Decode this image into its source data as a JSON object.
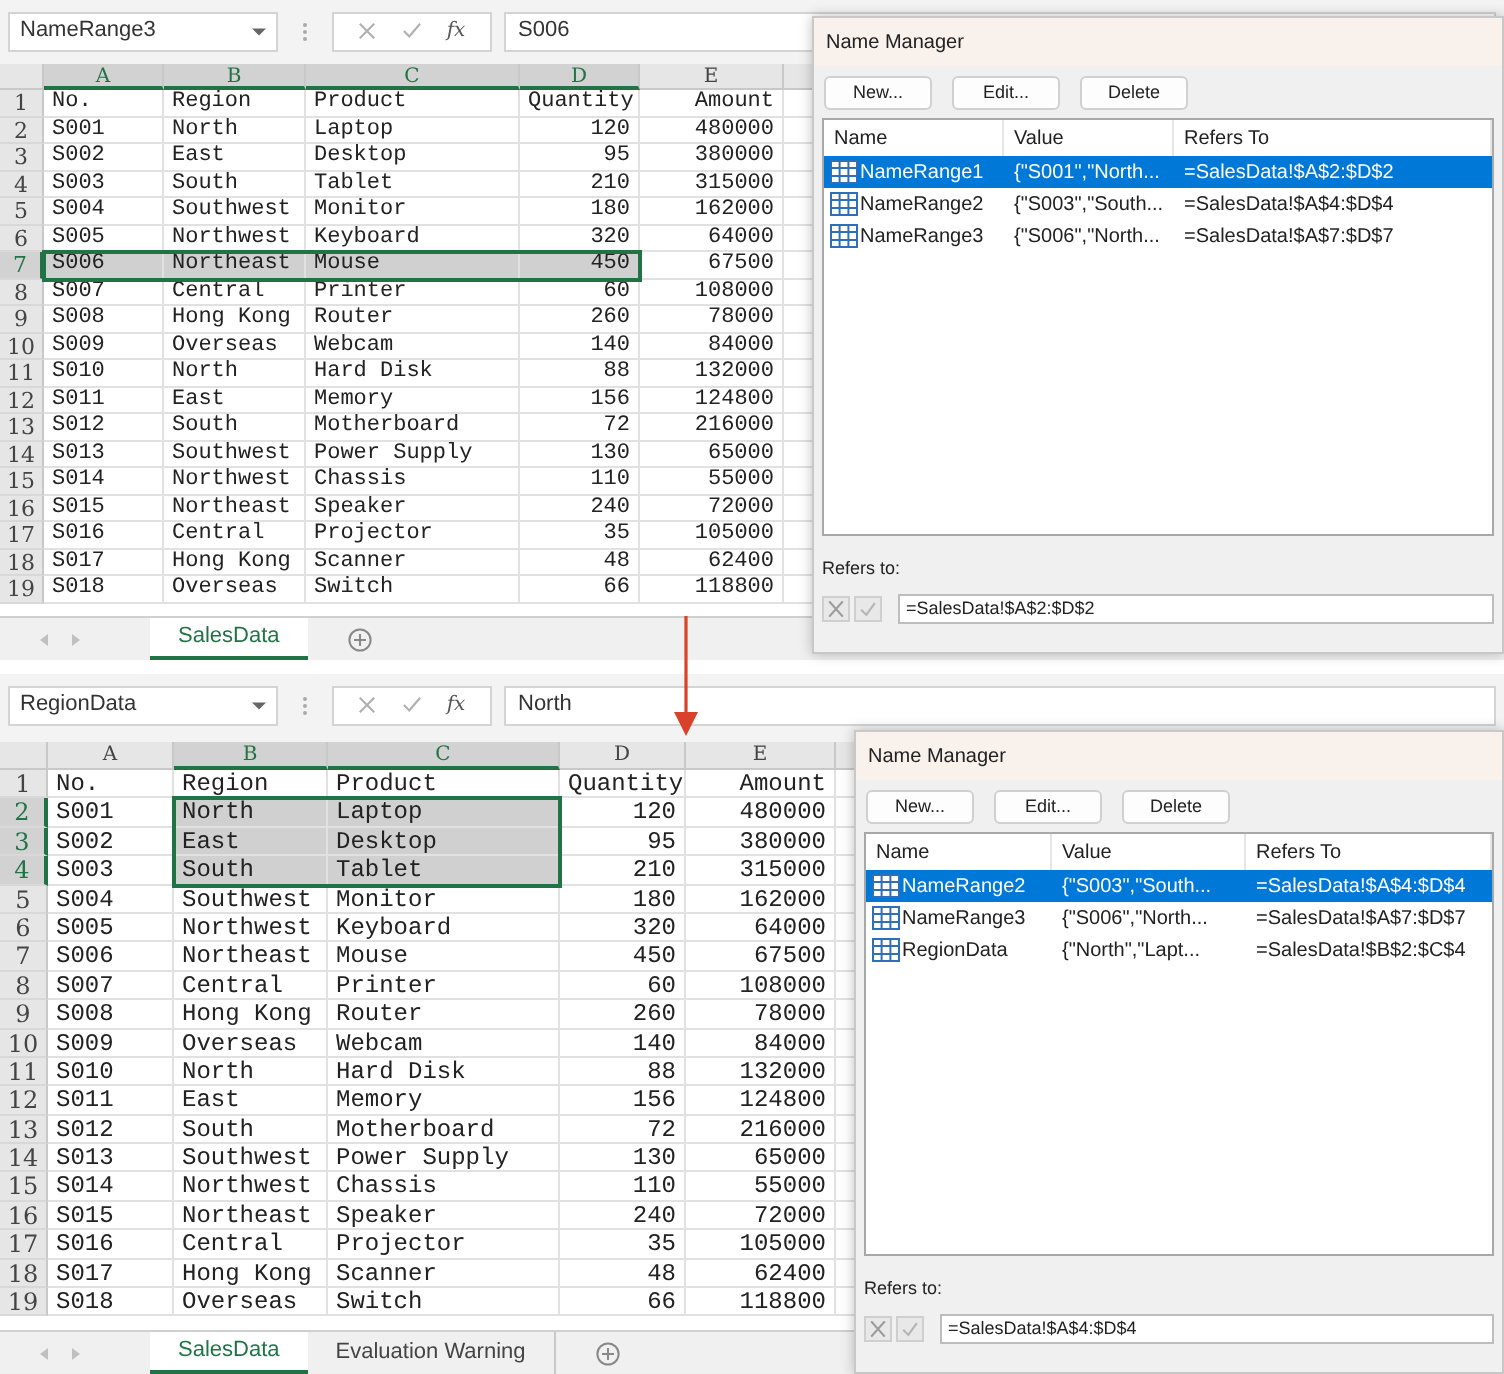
{
  "panels": [
    {
      "name_box": "NameRange3",
      "function_label": "fx",
      "formula": "S006",
      "columns": [
        {
          "label": "A",
          "selected": true
        },
        {
          "label": "B",
          "selected": true
        },
        {
          "label": "C",
          "selected": true
        },
        {
          "label": "D",
          "selected": true
        },
        {
          "label": "E",
          "selected": false
        }
      ],
      "rows": [
        {
          "number": "1",
          "selected": false,
          "cells": [
            "No.",
            "Region",
            "Product",
            "Quantity",
            "Amount"
          ]
        },
        {
          "number": "2",
          "selected": false,
          "cells": [
            "S001",
            "North",
            "Laptop",
            "120",
            "480000"
          ]
        },
        {
          "number": "3",
          "selected": false,
          "cells": [
            "S002",
            "East",
            "Desktop",
            "95",
            "380000"
          ]
        },
        {
          "number": "4",
          "selected": false,
          "cells": [
            "S003",
            "South",
            "Tablet",
            "210",
            "315000"
          ]
        },
        {
          "number": "5",
          "selected": false,
          "cells": [
            "S004",
            "Southwest",
            "Monitor",
            "180",
            "162000"
          ]
        },
        {
          "number": "6",
          "selected": false,
          "cells": [
            "S005",
            "Northwest",
            "Keyboard",
            "320",
            "64000"
          ]
        },
        {
          "number": "7",
          "selected": true,
          "cells": [
            "S006",
            "Northeast",
            "Mouse",
            "450",
            "67500"
          ]
        },
        {
          "number": "8",
          "selected": false,
          "cells": [
            "S007",
            "Central",
            "Printer",
            "60",
            "108000"
          ]
        },
        {
          "number": "9",
          "selected": false,
          "cells": [
            "S008",
            "Hong Kong",
            "Router",
            "260",
            "78000"
          ]
        },
        {
          "number": "10",
          "selected": false,
          "cells": [
            "S009",
            "Overseas",
            "Webcam",
            "140",
            "84000"
          ]
        },
        {
          "number": "11",
          "selected": false,
          "cells": [
            "S010",
            "North",
            "Hard Disk",
            "88",
            "132000"
          ]
        },
        {
          "number": "12",
          "selected": false,
          "cells": [
            "S011",
            "East",
            "Memory",
            "156",
            "124800"
          ]
        },
        {
          "number": "13",
          "selected": false,
          "cells": [
            "S012",
            "South",
            "Motherboard",
            "72",
            "216000"
          ]
        },
        {
          "number": "14",
          "selected": false,
          "cells": [
            "S013",
            "Southwest",
            "Power Supply",
            "130",
            "65000"
          ]
        },
        {
          "number": "15",
          "selected": false,
          "cells": [
            "S014",
            "Northwest",
            "Chassis",
            "110",
            "55000"
          ]
        },
        {
          "number": "16",
          "selected": false,
          "cells": [
            "S015",
            "Northeast",
            "Speaker",
            "240",
            "72000"
          ]
        },
        {
          "number": "17",
          "selected": false,
          "cells": [
            "S016",
            "Central",
            "Projector",
            "35",
            "105000"
          ]
        },
        {
          "number": "18",
          "selected": false,
          "cells": [
            "S017",
            "Hong Kong",
            "Scanner",
            "48",
            "62400"
          ]
        },
        {
          "number": "19",
          "selected": false,
          "cells": [
            "S018",
            "Overseas",
            "Switch",
            "66",
            "118800"
          ]
        }
      ],
      "sheet_tabs": [
        {
          "label": "SalesData",
          "selected": true
        }
      ],
      "dialog": {
        "title": "Name Manager",
        "buttons": [
          "New...",
          "Edit...",
          "Delete"
        ],
        "list_columns": [
          "Name",
          "Value",
          "Refers To"
        ],
        "names": [
          {
            "name": "NameRange1",
            "value": "{\"S001\",\"North...",
            "refers_to": "=SalesData!$A$2:$D$2",
            "selected": true
          },
          {
            "name": "NameRange2",
            "value": "{\"S003\",\"South...",
            "refers_to": "=SalesData!$A$4:$D$4",
            "selected": false
          },
          {
            "name": "NameRange3",
            "value": "{\"S006\",\"North...",
            "refers_to": "=SalesData!$A$7:$D$7",
            "selected": false
          }
        ],
        "refers_to_label": "Refers to:",
        "refers_to_value": "=SalesData!$A$2:$D$2"
      }
    },
    {
      "name_box": "RegionData",
      "function_label": "fx",
      "formula": "North",
      "columns": [
        {
          "label": "A",
          "selected": false
        },
        {
          "label": "B",
          "selected": true
        },
        {
          "label": "C",
          "selected": true
        },
        {
          "label": "D",
          "selected": false
        },
        {
          "label": "E",
          "selected": false
        }
      ],
      "rows": [
        {
          "number": "1",
          "selected": false,
          "cells": [
            "No.",
            "Region",
            "Product",
            "Quantity",
            "Amount"
          ]
        },
        {
          "number": "2",
          "selected": true,
          "cells": [
            "S001",
            "North",
            "Laptop",
            "120",
            "480000"
          ]
        },
        {
          "number": "3",
          "selected": true,
          "cells": [
            "S002",
            "East",
            "Desktop",
            "95",
            "380000"
          ]
        },
        {
          "number": "4",
          "selected": true,
          "cells": [
            "S003",
            "South",
            "Tablet",
            "210",
            "315000"
          ]
        },
        {
          "number": "5",
          "selected": false,
          "cells": [
            "S004",
            "Southwest",
            "Monitor",
            "180",
            "162000"
          ]
        },
        {
          "number": "6",
          "selected": false,
          "cells": [
            "S005",
            "Northwest",
            "Keyboard",
            "320",
            "64000"
          ]
        },
        {
          "number": "7",
          "selected": false,
          "cells": [
            "S006",
            "Northeast",
            "Mouse",
            "450",
            "67500"
          ]
        },
        {
          "number": "8",
          "selected": false,
          "cells": [
            "S007",
            "Central",
            "Printer",
            "60",
            "108000"
          ]
        },
        {
          "number": "9",
          "selected": false,
          "cells": [
            "S008",
            "Hong Kong",
            "Router",
            "260",
            "78000"
          ]
        },
        {
          "number": "10",
          "selected": false,
          "cells": [
            "S009",
            "Overseas",
            "Webcam",
            "140",
            "84000"
          ]
        },
        {
          "number": "11",
          "selected": false,
          "cells": [
            "S010",
            "North",
            "Hard Disk",
            "88",
            "132000"
          ]
        },
        {
          "number": "12",
          "selected": false,
          "cells": [
            "S011",
            "East",
            "Memory",
            "156",
            "124800"
          ]
        },
        {
          "number": "13",
          "selected": false,
          "cells": [
            "S012",
            "South",
            "Motherboard",
            "72",
            "216000"
          ]
        },
        {
          "number": "14",
          "selected": false,
          "cells": [
            "S013",
            "Southwest",
            "Power Supply",
            "130",
            "65000"
          ]
        },
        {
          "number": "15",
          "selected": false,
          "cells": [
            "S014",
            "Northwest",
            "Chassis",
            "110",
            "55000"
          ]
        },
        {
          "number": "16",
          "selected": false,
          "cells": [
            "S015",
            "Northeast",
            "Speaker",
            "240",
            "72000"
          ]
        },
        {
          "number": "17",
          "selected": false,
          "cells": [
            "S016",
            "Central",
            "Projector",
            "35",
            "105000"
          ]
        },
        {
          "number": "18",
          "selected": false,
          "cells": [
            "S017",
            "Hong Kong",
            "Scanner",
            "48",
            "62400"
          ]
        },
        {
          "number": "19",
          "selected": false,
          "cells": [
            "S018",
            "Overseas",
            "Switch",
            "66",
            "118800"
          ]
        }
      ],
      "sheet_tabs": [
        {
          "label": "SalesData",
          "selected": true
        },
        {
          "label": "Evaluation Warning",
          "selected": false
        }
      ],
      "dialog": {
        "title": "Name Manager",
        "buttons": [
          "New...",
          "Edit...",
          "Delete"
        ],
        "list_columns": [
          "Name",
          "Value",
          "Refers To"
        ],
        "names": [
          {
            "name": "NameRange2",
            "value": "{\"S003\",\"South...",
            "refers_to": "=SalesData!$A$4:$D$4",
            "selected": true
          },
          {
            "name": "NameRange3",
            "value": "{\"S006\",\"North...",
            "refers_to": "=SalesData!$A$7:$D$7",
            "selected": false
          },
          {
            "name": "RegionData",
            "value": "{\"North\",\"Lapt...",
            "refers_to": "=SalesData!$B$2:$C$4",
            "selected": false
          }
        ],
        "refers_to_label": "Refers to:",
        "refers_to_value": "=SalesData!$A$4:$D$4"
      }
    }
  ]
}
